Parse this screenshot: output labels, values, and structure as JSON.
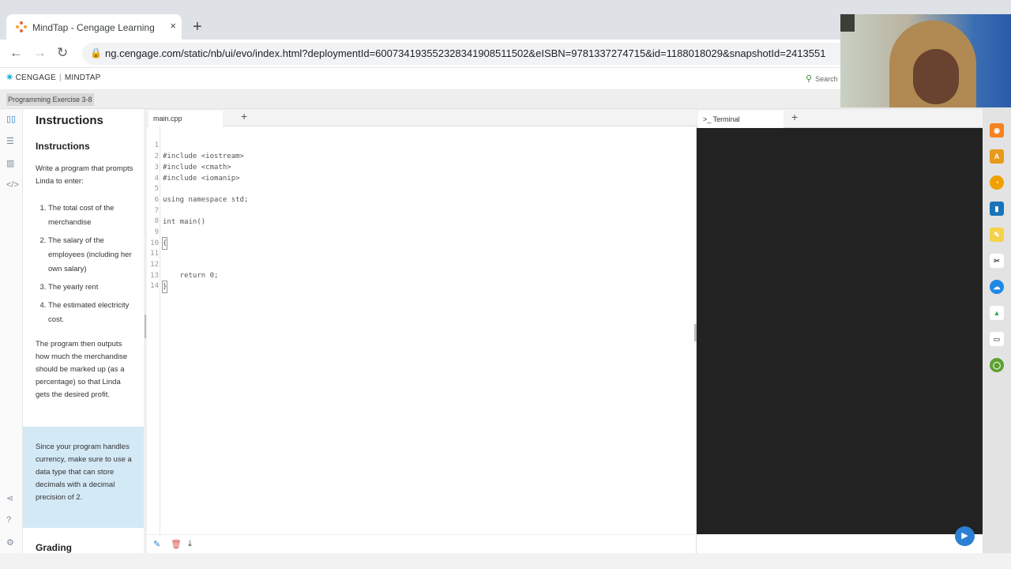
{
  "browser": {
    "tab_title": "MindTap - Cengage Learning",
    "tab_close": "×",
    "new_tab": "+",
    "url": "ng.cengage.com/static/nb/ui/evo/index.html?deploymentId=600734193552328341908511502&eISBN=9781337274715&id=1188018029&snapshotId=2413551"
  },
  "header": {
    "brand_left": "CENGAGE",
    "brand_right": "MINDTAP",
    "search_label": "Search"
  },
  "breadcrumb": "Programming Exercise 3-8",
  "instructions": {
    "panel_title": "Instructions",
    "section_title": "Instructions",
    "intro": "Write a program that prompts Linda to enter:",
    "items": [
      "The total cost of the merchandise",
      "The salary of the employees (including her own salary)",
      "The yearly rent",
      "The estimated electricity cost."
    ],
    "outro": "The program then outputs how much the merchandise should be marked up (as a percentage) so that Linda gets the desired profit.",
    "note": "Since your program handles currency, make sure to use a data type that can store decimals with a decimal precision of 2.",
    "grading_title": "Grading"
  },
  "editor": {
    "tab_label": "main.cpp",
    "add_label": "+",
    "lines": [
      {
        "n": "1",
        "text": "#include <iostream>"
      },
      {
        "n": "2",
        "text": "#include <cmath>"
      },
      {
        "n": "3",
        "text": "#include <iomanip>"
      },
      {
        "n": "4",
        "text": ""
      },
      {
        "n": "5",
        "text": "using namespace std;"
      },
      {
        "n": "6",
        "text": ""
      },
      {
        "n": "7",
        "text": "int main()"
      },
      {
        "n": "8",
        "text": ""
      },
      {
        "n": "9",
        "text": "{"
      },
      {
        "n": "10",
        "text": ""
      },
      {
        "n": "11",
        "text": ""
      },
      {
        "n": "12",
        "text": "    return 0;"
      },
      {
        "n": "13",
        "text": "}"
      },
      {
        "n": "14",
        "text": ""
      }
    ]
  },
  "terminal": {
    "tab_label": "Terminal",
    "tab_prefix": ">_",
    "add_label": "+"
  },
  "colors": {
    "note_bg": "#d4e9f6",
    "terminal_bg": "#222222",
    "accent": "#2b7fd4"
  }
}
